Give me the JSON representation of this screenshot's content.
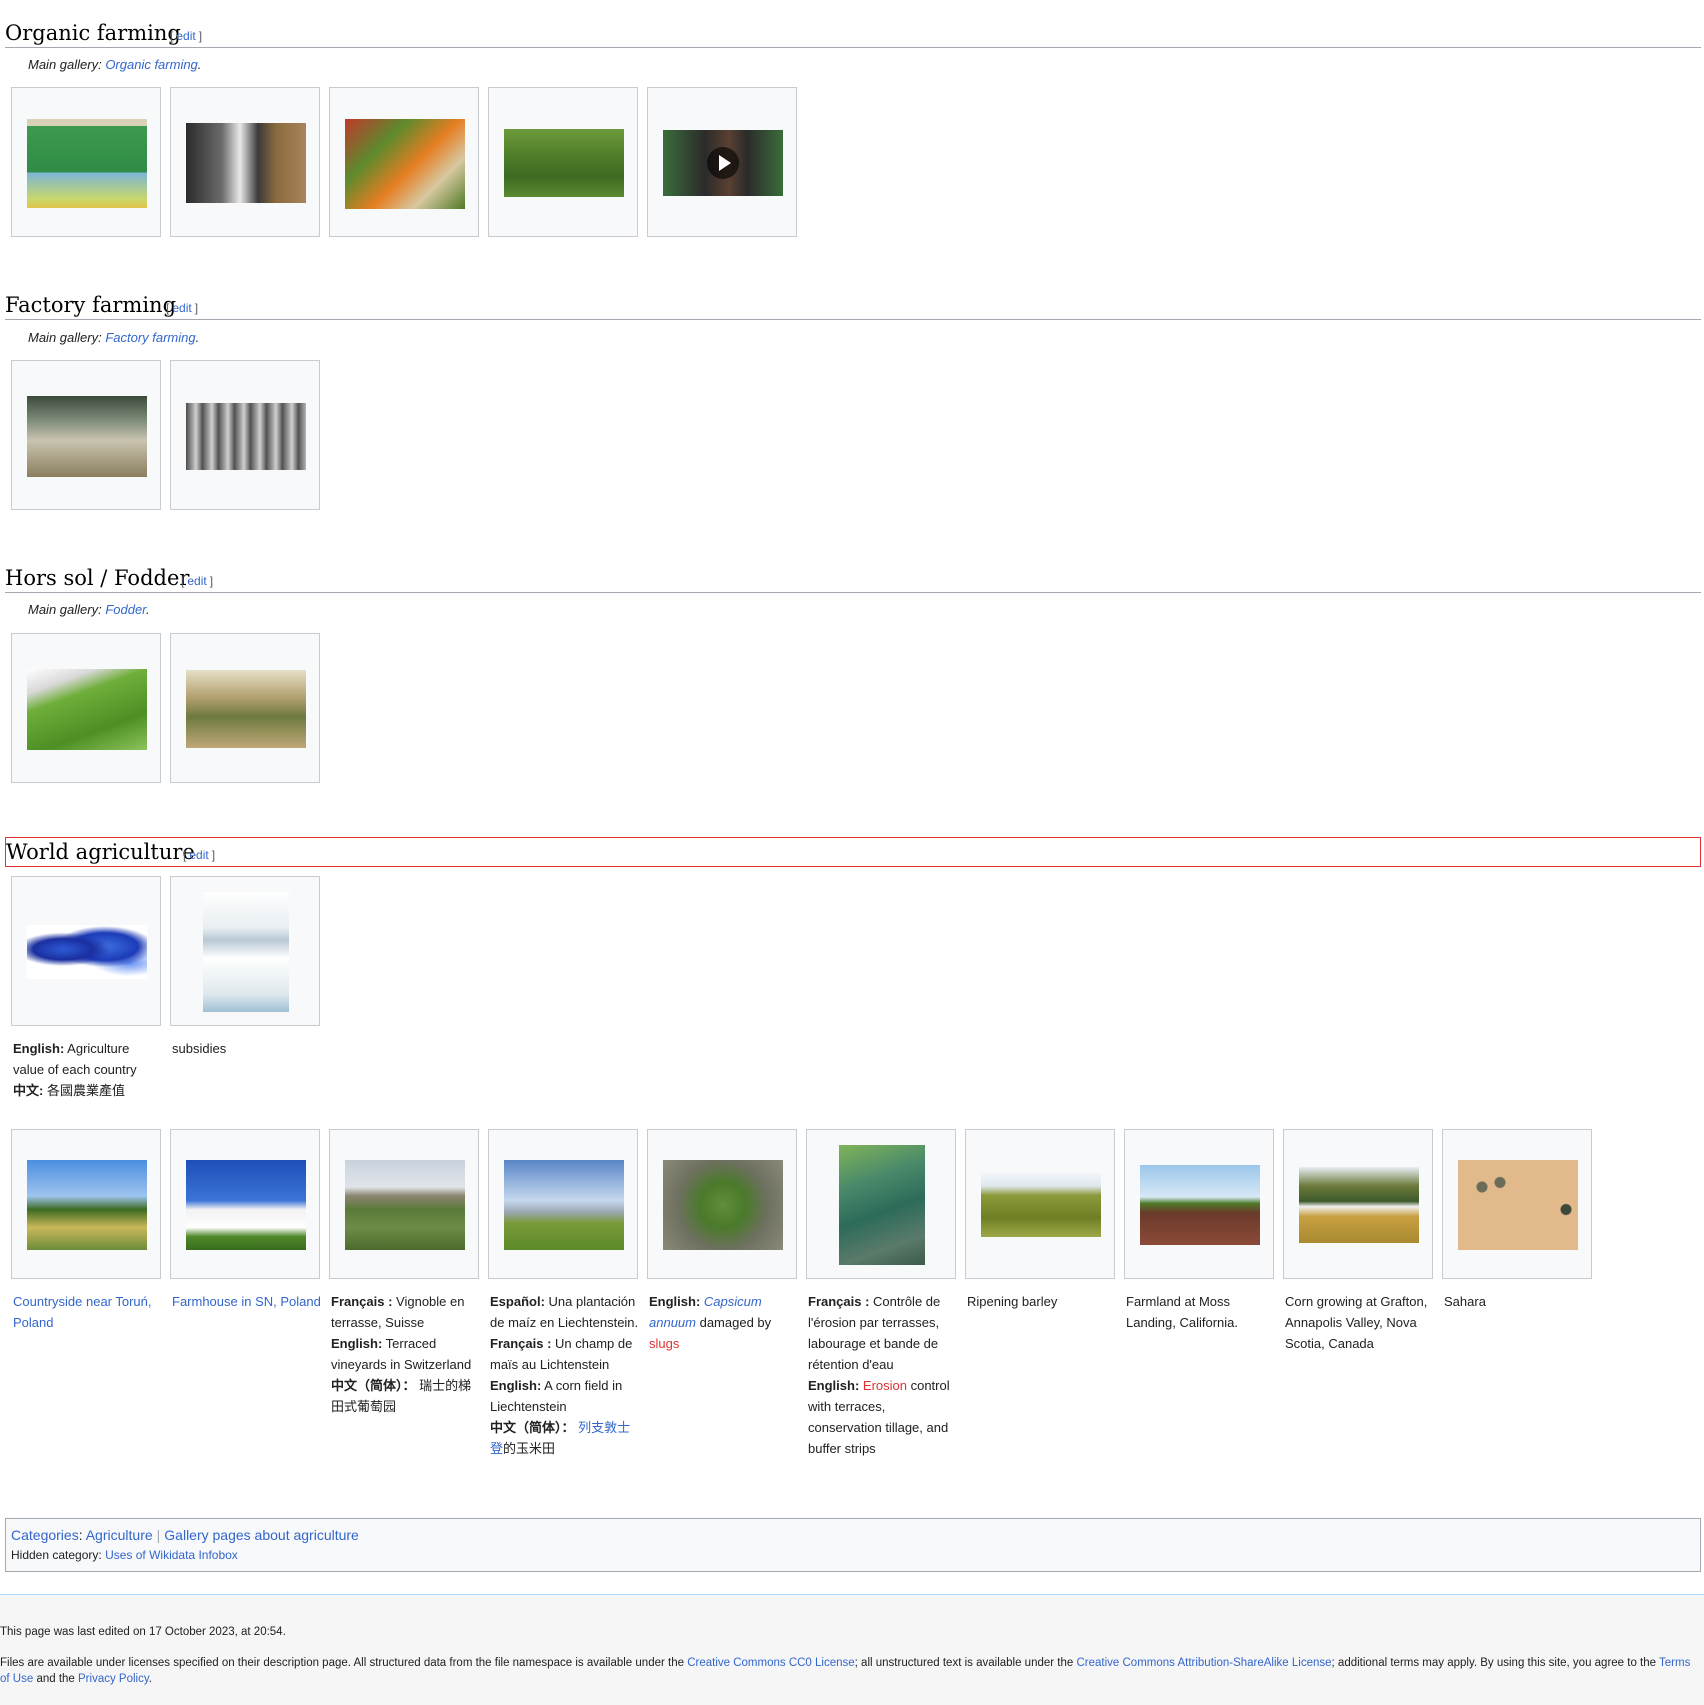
{
  "sections": {
    "organic": {
      "title": "Organic farming",
      "edit": "edit",
      "hatnote_prefix": "Main gallery: ",
      "hatnote_link": "Organic farming",
      "hatnote_suffix": "."
    },
    "factory": {
      "title": "Factory farming",
      "edit": "edit",
      "hatnote_prefix": "Main gallery: ",
      "hatnote_link": "Factory farming",
      "hatnote_suffix": "."
    },
    "fodder": {
      "title": "Hors sol / Fodder",
      "edit": "edit",
      "hatnote_prefix": "Main gallery: ",
      "hatnote_link": "Fodder",
      "hatnote_suffix": "."
    },
    "world": {
      "title": "World agriculture",
      "edit": "edit"
    }
  },
  "edit_brackets": {
    "open": "[",
    "close": "]"
  },
  "world_captions": {
    "map": {
      "lang1": "English:",
      "text1": " Agriculture value of each country",
      "lang2": "中文:",
      "text2": " 各國農業產值"
    },
    "subsidies": "subsidies"
  },
  "gallery_captions": {
    "torun": "Countryside near Toruń, Poland",
    "farmhouse": "Farmhouse in SN, Poland",
    "vineyard": {
      "fr_lang": "Français :",
      "fr": " Vignoble en terrasse, Suisse",
      "en_lang": "English:",
      "en": " Terraced vineyards in Switzerland",
      "zh_lang": "中文（简体）：",
      "zh": " 瑞士的梯田式葡萄园"
    },
    "corn": {
      "es_lang": "Español:",
      "es": " Una plantación de maíz en Liechtenstein.",
      "fr_lang": "Français :",
      "fr": " Un champ de maïs au Lichtenstein",
      "en_lang": "English:",
      "en": " A corn field in Liechtenstein",
      "zh_lang": "中文（简体）：",
      "zh_link": " 列支敦士登",
      "zh": "的玉米田"
    },
    "capsicum": {
      "en_lang": "English:",
      "link": "Capsicum annuum",
      "mid": " damaged by ",
      "redlink": "slugs"
    },
    "erosion": {
      "fr_lang": "Français :",
      "fr": " Contrôle de l'érosion par terrasses, labourage et bande de rétention d'eau",
      "en_lang": "English:",
      "redlink": "Erosion",
      "en": " control with terraces, conservation tillage, and buffer strips"
    },
    "barley": "Ripening barley",
    "moss": "Farmland at Moss Landing, California.",
    "grafton": "Corn growing at Grafton, Annapolis Valley, Nova Scotia, Canada",
    "sahara": "Sahara"
  },
  "categories": {
    "label": "Categories",
    "items": [
      "Agriculture",
      "Gallery pages about agriculture"
    ],
    "hidden_label": "Hidden category:",
    "hidden_items": [
      "Uses of Wikidata Infobox"
    ]
  },
  "footer": {
    "last_edited": "This page was last edited on 17 October 2023, at 20:54.",
    "license_1": "Files are available under licenses specified on their description page. All structured data from the file namespace is available under the ",
    "cc0": "Creative Commons CC0 License",
    "license_2": "; all unstructured text is available under the ",
    "ccbysa": "Creative Commons Attribution-ShareAlike License",
    "license_3": "; additional terms may apply. By using this site, you agree to the ",
    "terms": "Terms of Use",
    "and": " and the ",
    "privacy": "Privacy Policy",
    "end": "."
  }
}
